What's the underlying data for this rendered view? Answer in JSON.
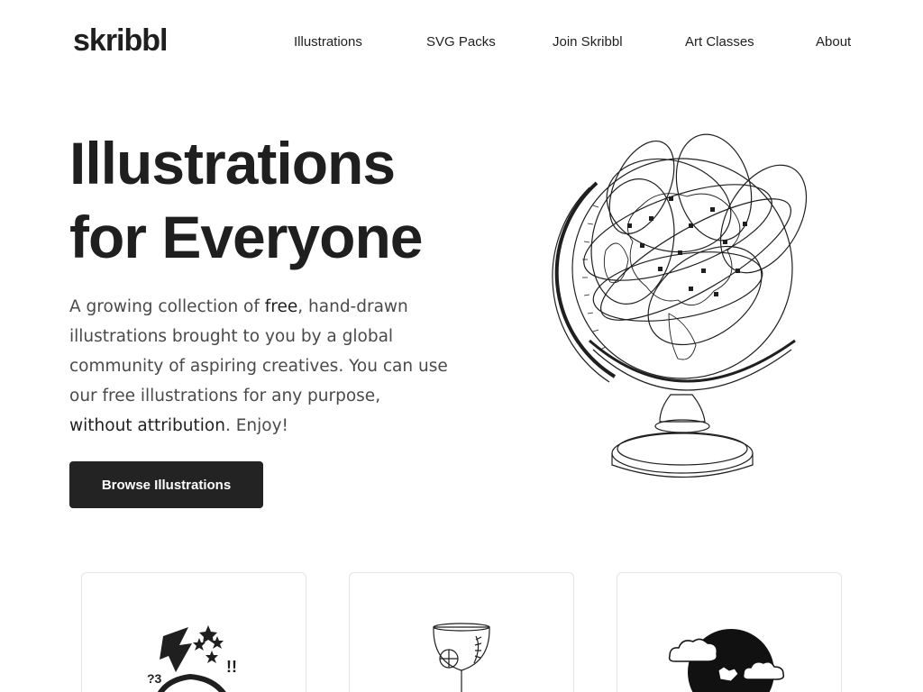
{
  "nav": {
    "logo": "skribbl",
    "links": [
      "Illustrations",
      "SVG Packs",
      "Join Skribbl",
      "Art Classes",
      "About"
    ]
  },
  "hero": {
    "title_line1": "Illustrations",
    "title_line2": "for Everyone",
    "text_a": "A growing collection of ",
    "text_free": "free",
    "text_b": ", hand-drawn illustrations brought to you by a global community of aspiring creatives. You can use our free illustrations for any purpose, ",
    "text_noattr": "without attribution",
    "text_c": ". Enjoy!",
    "cta_label": "Browse Illustrations"
  },
  "illustrations": {
    "hero_icon": "globe-illustration",
    "cards": [
      {
        "icon": "astronaut-stars-illustration"
      },
      {
        "icon": "cocktail-glass-illustration"
      },
      {
        "icon": "moon-clouds-illustration"
      }
    ]
  }
}
